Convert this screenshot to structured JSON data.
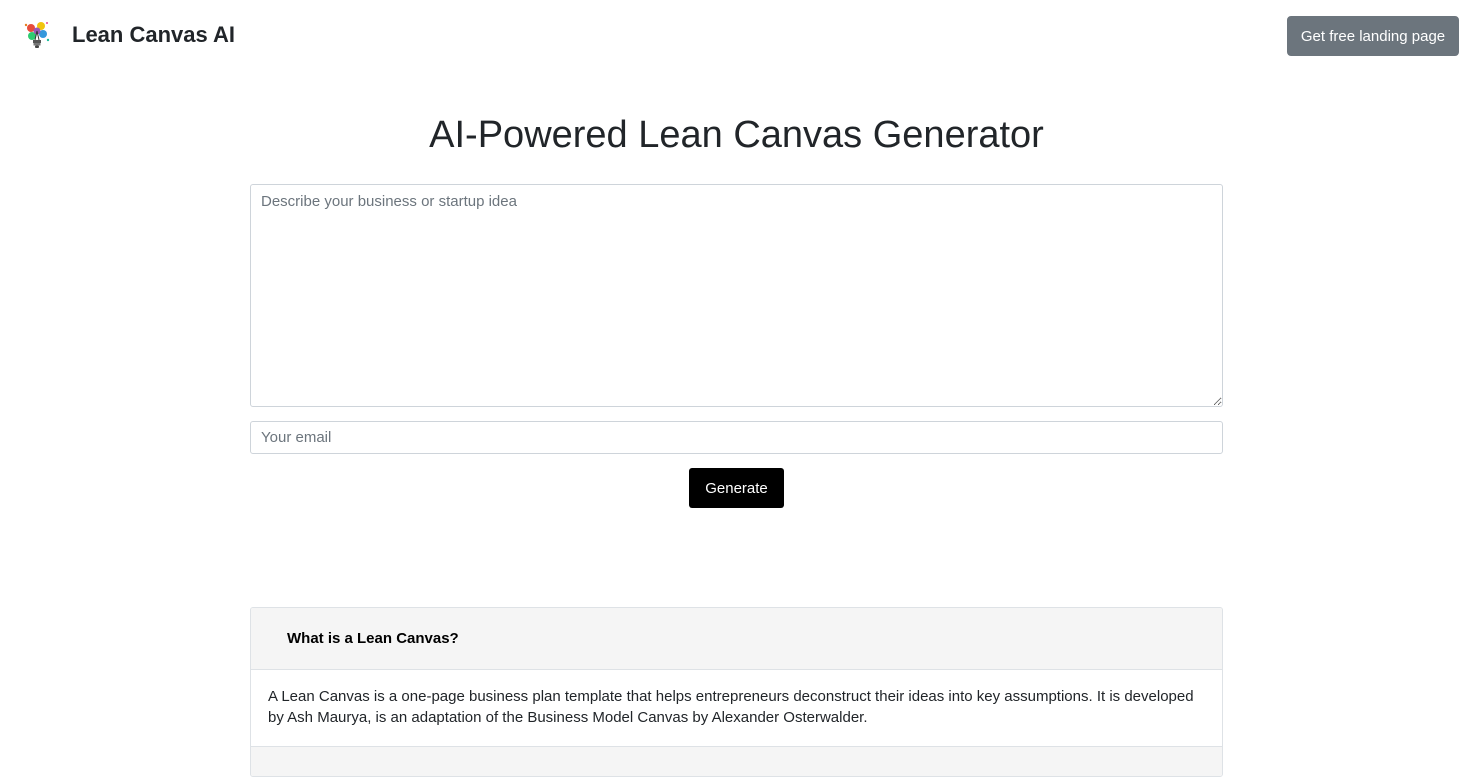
{
  "navbar": {
    "brand": "Lean Canvas AI",
    "logo_icon": "lightbulb-logo-icon",
    "cta_label": "Get free landing page"
  },
  "main": {
    "title": "AI-Powered Lean Canvas Generator",
    "idea_placeholder": "Describe your business or startup idea",
    "email_placeholder": "Your email",
    "generate_label": "Generate"
  },
  "faq": {
    "items": [
      {
        "question": "What is a Lean Canvas?",
        "answer": "A Lean Canvas is a one-page business plan template that helps entrepreneurs deconstruct their ideas into key assumptions. It is developed by Ash Maurya, is an adaptation of the Business Model Canvas by Alexander Osterwalder."
      }
    ]
  },
  "colors": {
    "cta_bg": "#6c757d",
    "generate_bg": "#000000",
    "faq_header_bg": "#f5f5f5"
  }
}
